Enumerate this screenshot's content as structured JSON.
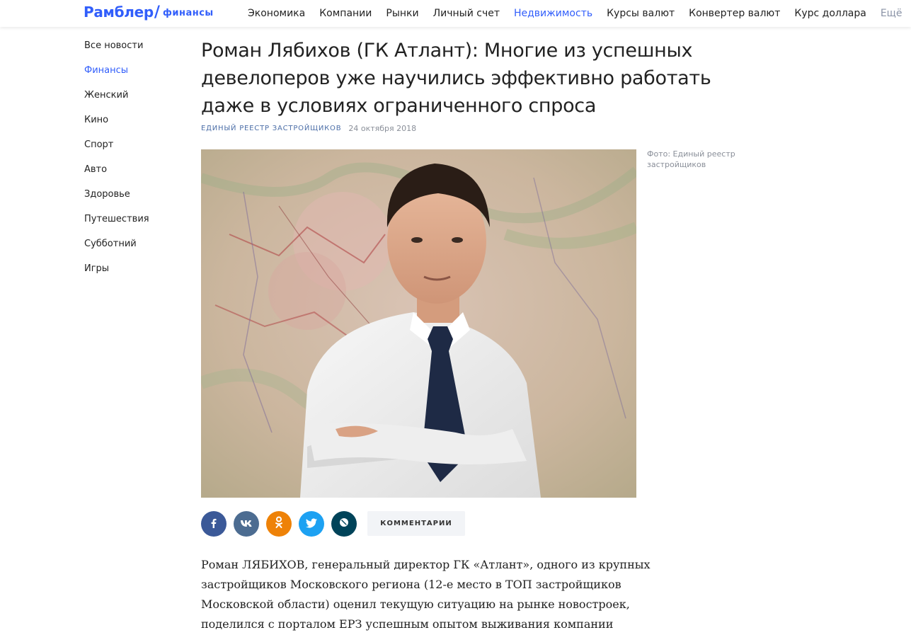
{
  "header": {
    "logo_main": "Рамблер",
    "logo_slash": "/",
    "logo_sub": "финансы",
    "nav": [
      {
        "label": "Экономика"
      },
      {
        "label": "Компании"
      },
      {
        "label": "Рынки"
      },
      {
        "label": "Личный счет"
      },
      {
        "label": "Недвижимость",
        "active": true
      },
      {
        "label": "Курсы валют"
      },
      {
        "label": "Конвертер валют"
      },
      {
        "label": "Курс доллара"
      }
    ],
    "more_label": "Ещё"
  },
  "sidebar": {
    "items": [
      {
        "label": "Все новости"
      },
      {
        "label": "Финансы",
        "active": true
      },
      {
        "label": "Женский"
      },
      {
        "label": "Кино"
      },
      {
        "label": "Спорт"
      },
      {
        "label": "Авто"
      },
      {
        "label": "Здоровье"
      },
      {
        "label": "Путешествия"
      },
      {
        "label": "Субботний"
      },
      {
        "label": "Игры"
      }
    ]
  },
  "article": {
    "title": "Роман Лябихов (ГК Атлант): Многие из успешных девелоперов уже научились эффективно работать даже в условиях ограниченного спроса",
    "source": "ЕДИНЫЙ РЕЕСТР ЗАСТРОЙЩИКОВ",
    "date": "24 октября 2018",
    "photo_caption": "Фото: Единый реестр застройщиков",
    "comments_label": "КОММЕНТАРИИ",
    "body": "Роман ЛЯБИХОВ, генеральный директор ГК «Атлант», одного из крупных застройщиков Московского региона (12-е место в ТОП застройщиков Московской области) оценил текущую ситуацию на рынке новостроек, поделился с порталом ЕРЗ успешным опытом выживания компании"
  },
  "share": {
    "buttons": [
      {
        "name": "facebook",
        "color": "#3b5998"
      },
      {
        "name": "vk",
        "color": "#4c6c91"
      },
      {
        "name": "odnoklassniki",
        "color": "#ee8208"
      },
      {
        "name": "twitter",
        "color": "#1da1f2"
      },
      {
        "name": "livejournal",
        "color": "#004359"
      }
    ]
  },
  "colors": {
    "accent": "#315efb",
    "source": "#4d6fa8",
    "muted": "#8a8f99"
  }
}
